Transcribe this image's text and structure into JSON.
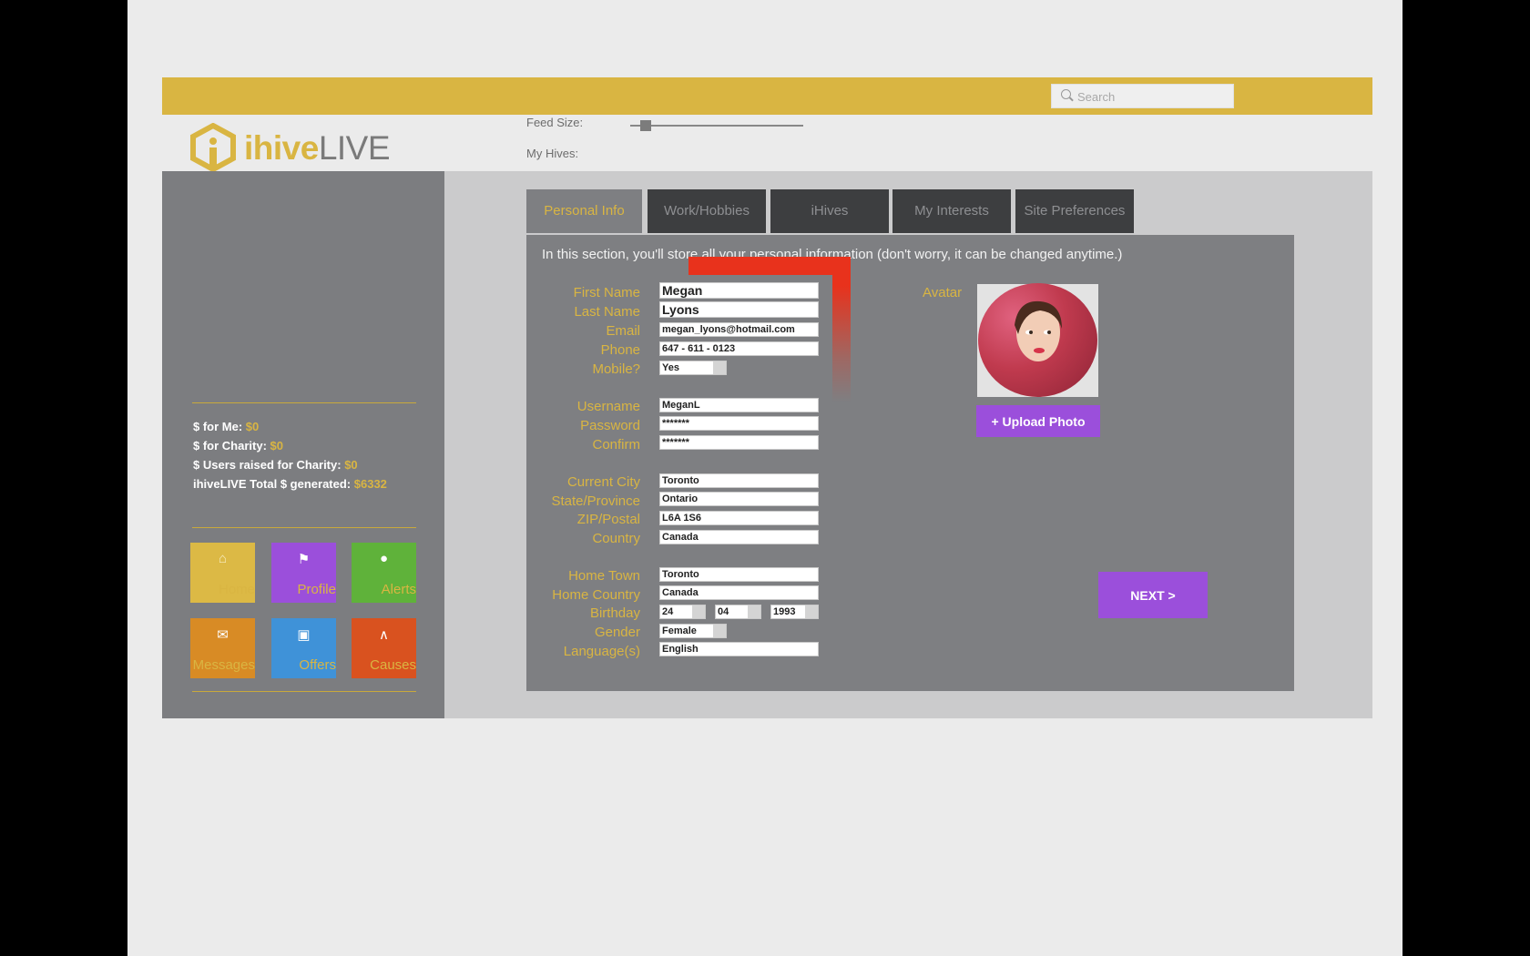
{
  "search": {
    "placeholder": "Search"
  },
  "header": {
    "logo_word_1": "ihive",
    "logo_word_2": "LIVE",
    "feed_size_label": "Feed Size:",
    "feed_size_level": 0.06,
    "my_hives_label": "My Hives:"
  },
  "sidebar": {
    "stats": [
      {
        "label": "$ for Me: ",
        "value": "$0"
      },
      {
        "label": "$ for Charity: ",
        "value": "$0"
      },
      {
        "label": "$ Users  raised for Charity: ",
        "value": "$0"
      },
      {
        "label": "ihiveLIVE Total $ generated: ",
        "value": "$6332"
      }
    ],
    "tiles": [
      {
        "label": "Home",
        "icon": "home-icon",
        "color": "#dcb945"
      },
      {
        "label": "Profile",
        "icon": "wrench-icon",
        "color": "#9b4fdb"
      },
      {
        "label": "Alerts",
        "icon": "bell-icon",
        "color": "#5fb23a"
      },
      {
        "label": "Messages",
        "icon": "envelope-icon",
        "color": "#d88b25"
      },
      {
        "label": "Offers",
        "icon": "gift-icon",
        "color": "#3f92d8"
      },
      {
        "label": "Causes",
        "icon": "ribbon-icon",
        "color": "#d9521f"
      }
    ]
  },
  "tabs": [
    "Personal Info",
    "Work/Hobbies",
    "iHives",
    "My Interests",
    "Site Preferences"
  ],
  "form": {
    "intro": "In this section, you'll store all your personal information (don't worry, it can be changed anytime.)",
    "first_name": {
      "label": "First Name",
      "value": "Megan"
    },
    "last_name": {
      "label": "Last Name",
      "value": "Lyons"
    },
    "email": {
      "label": "Email",
      "value": "megan_lyons@hotmail.com"
    },
    "phone": {
      "label": "Phone",
      "value": "647 - 611 - 0123"
    },
    "mobile": {
      "label": "Mobile?",
      "value": "Yes"
    },
    "username": {
      "label": "Username",
      "value": "MeganL"
    },
    "password": {
      "label": "Password",
      "value": "*******"
    },
    "confirm": {
      "label": "Confirm",
      "value": "*******"
    },
    "current_city": {
      "label": "Current City",
      "value": "Toronto"
    },
    "state": {
      "label": "State/Province",
      "value": "Ontario"
    },
    "zip": {
      "label": "ZIP/Postal",
      "value": "L6A 1S6"
    },
    "country": {
      "label": "Country",
      "value": "Canada"
    },
    "home_town": {
      "label": "Home Town",
      "value": "Toronto"
    },
    "home_country": {
      "label": "Home Country",
      "value": "Canada"
    },
    "birthday": {
      "label": "Birthday",
      "day": "24",
      "month": "04",
      "year": "1993"
    },
    "gender": {
      "label": "Gender",
      "value": "Female"
    },
    "languages": {
      "label": "Language(s)",
      "value": "English"
    },
    "avatar_label": "Avatar",
    "upload_label": "+ Upload Photo"
  },
  "next_label": "NEXT >",
  "colors": {
    "gold": "#d9b542",
    "purple": "#9b4fdb",
    "sidebar": "#7c7d80",
    "annotation": "#e8321c"
  }
}
